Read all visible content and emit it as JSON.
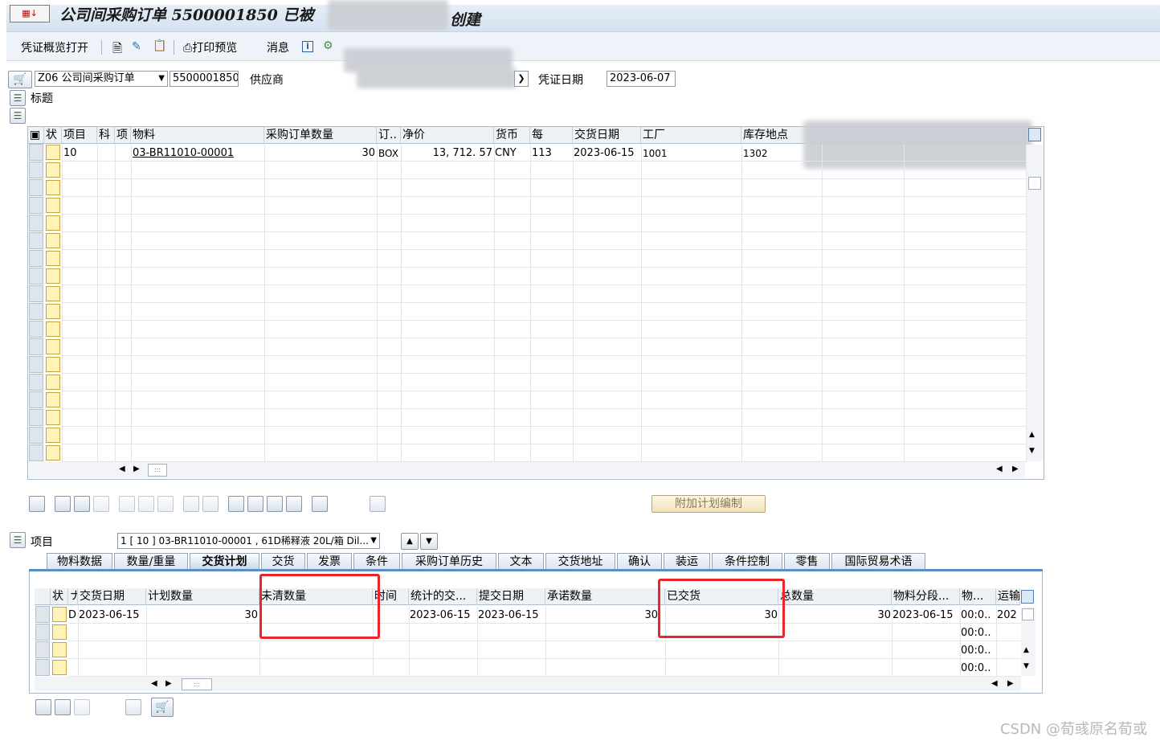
{
  "title": "公司间采购订单 5500001850 已被",
  "title_suffix": "创建",
  "toolbar": {
    "overview": "凭证概览打开",
    "print_preview": "打印预览",
    "messages": "消息"
  },
  "header": {
    "doc_type": "Z06 公司间采购订单",
    "po_number": "5500001850",
    "vendor_label": "供应商",
    "doc_date_label": "凭证日期",
    "doc_date": "2023-06-07",
    "header_label": "标题"
  },
  "items_table": {
    "columns": [
      "状",
      "项目",
      "科",
      "项",
      "物料",
      "采购订单数量",
      "订..",
      "净价",
      "货币",
      "每",
      "交货日期",
      "工厂",
      "库存地点"
    ],
    "rows": [
      {
        "item": "10",
        "material": "03-BR11010-00001",
        "qty": "30",
        "unit": "BOX",
        "price": "13, 712. 57",
        "currency": "CNY",
        "per": "113",
        "delivery": "2023-06-15",
        "plant": "1001",
        "storage": "1302"
      }
    ]
  },
  "actions": {
    "extra_plan": "附加计划编制"
  },
  "item_detail": {
    "label": "项目",
    "selected": "1 [ 10 ] 03-BR11010-00001 , 61D稀释液 20L/箱 Dil..."
  },
  "tabs": [
    "物料数据",
    "数量/重量",
    "交货计划",
    "交货",
    "发票",
    "条件",
    "采购订单历史",
    "文本",
    "交货地址",
    "确认",
    "装运",
    "条件控制",
    "零售",
    "国际贸易术语"
  ],
  "schedule_table": {
    "columns": [
      "状",
      "ナ",
      "交货日期",
      "计划数量",
      "未清数量",
      "时间",
      "统计的交...",
      "提交日期",
      "承诺数量",
      "已交货",
      "总数量",
      "物料分段...",
      "物...",
      "运输"
    ],
    "rows": [
      {
        "cat": "D",
        "date": "2023-06-15",
        "plan_qty": "30",
        "open_qty": "",
        "stat_date": "2023-06-15",
        "submit_date": "2023-06-15",
        "promise_qty": "30",
        "delivered": "30",
        "total_qty": "30",
        "mat_date": "2023-06-15",
        "time": "00:0..",
        "transport": "202"
      }
    ],
    "empty_times": [
      "00:0..",
      "00:0..",
      "00:0.."
    ]
  },
  "watermark": "CSDN @荀彧原名荀或"
}
